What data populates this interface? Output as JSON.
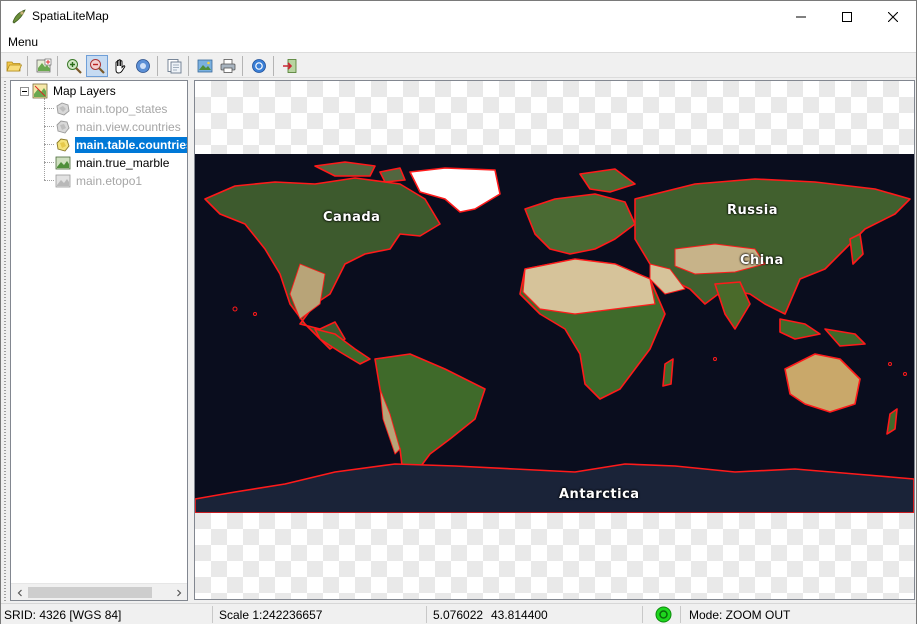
{
  "window": {
    "title": "SpatiaLiteMap",
    "controls": {
      "minimize": "minimize",
      "maximize": "maximize",
      "close": "close"
    }
  },
  "menu": {
    "items": [
      {
        "label": "Menu"
      }
    ]
  },
  "toolbar": {
    "buttons": [
      {
        "icon": "open-folder-icon"
      },
      {
        "icon": "layer-add-icon"
      },
      {
        "icon": "zoom-in-icon"
      },
      {
        "icon": "zoom-out-icon",
        "pressed": true
      },
      {
        "icon": "pan-hand-icon"
      },
      {
        "icon": "identify-icon"
      },
      {
        "icon": "layer-properties-icon"
      },
      {
        "icon": "export-image-icon"
      },
      {
        "icon": "print-icon"
      },
      {
        "icon": "about-icon"
      },
      {
        "icon": "exit-icon"
      }
    ]
  },
  "layers": {
    "root_label": "Map Layers",
    "items": [
      {
        "label": "main.topo_states",
        "state": "disabled",
        "icon": "vector-layer-icon"
      },
      {
        "label": "main.view.countries",
        "state": "disabled",
        "icon": "vector-layer-icon"
      },
      {
        "label": "main.table.countries",
        "state": "selected",
        "icon": "vector-layer-icon"
      },
      {
        "label": "main.true_marble",
        "state": "normal",
        "icon": "raster-layer-icon"
      },
      {
        "label": "main.etopo1",
        "state": "disabled",
        "icon": "raster-layer-icon"
      }
    ]
  },
  "map": {
    "labels": {
      "canada": "Canada",
      "russia": "Russia",
      "china": "China",
      "antarctica": "Antarctica"
    },
    "colors": {
      "ocean": "#0a0d1e",
      "border": "#ff1a1a",
      "land": "#3e5a2c",
      "desert": "#d6c39a",
      "ice": "#ffffff"
    }
  },
  "status": {
    "srid": "SRID: 4326 [WGS 84]",
    "scale": "Scale 1:242236657",
    "x": "5.076022",
    "y": "43.814400",
    "mode": "Mode: ZOOM OUT",
    "indicator_color": "#1ed61e"
  }
}
